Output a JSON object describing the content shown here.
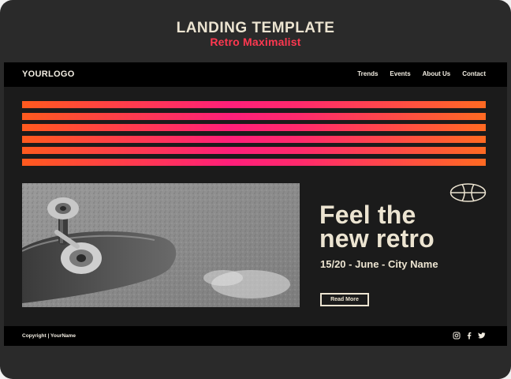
{
  "template": {
    "title": "LANDING TEMPLATE",
    "subtitle": "Retro Maximalist"
  },
  "header": {
    "logo": "YOURLOGO",
    "nav": [
      "Trends",
      "Events",
      "About Us",
      "Contact"
    ]
  },
  "hero": {
    "title": "Feel the\nnew retro",
    "date": "15/20 - June - City Name",
    "button_label": "Read More",
    "image": "skateboard-photo-grayscale"
  },
  "footer": {
    "copyright": "Copyright | YourName",
    "socials": [
      "instagram-icon",
      "facebook-icon",
      "twitter-icon"
    ]
  },
  "colors": {
    "background": "#2a2a2a",
    "page": "#1b1b1b",
    "text": "#ece4d1",
    "accent": "#ff3850",
    "stripe_start": "#ff5a1e",
    "stripe_mid": "#ff1f7a"
  }
}
